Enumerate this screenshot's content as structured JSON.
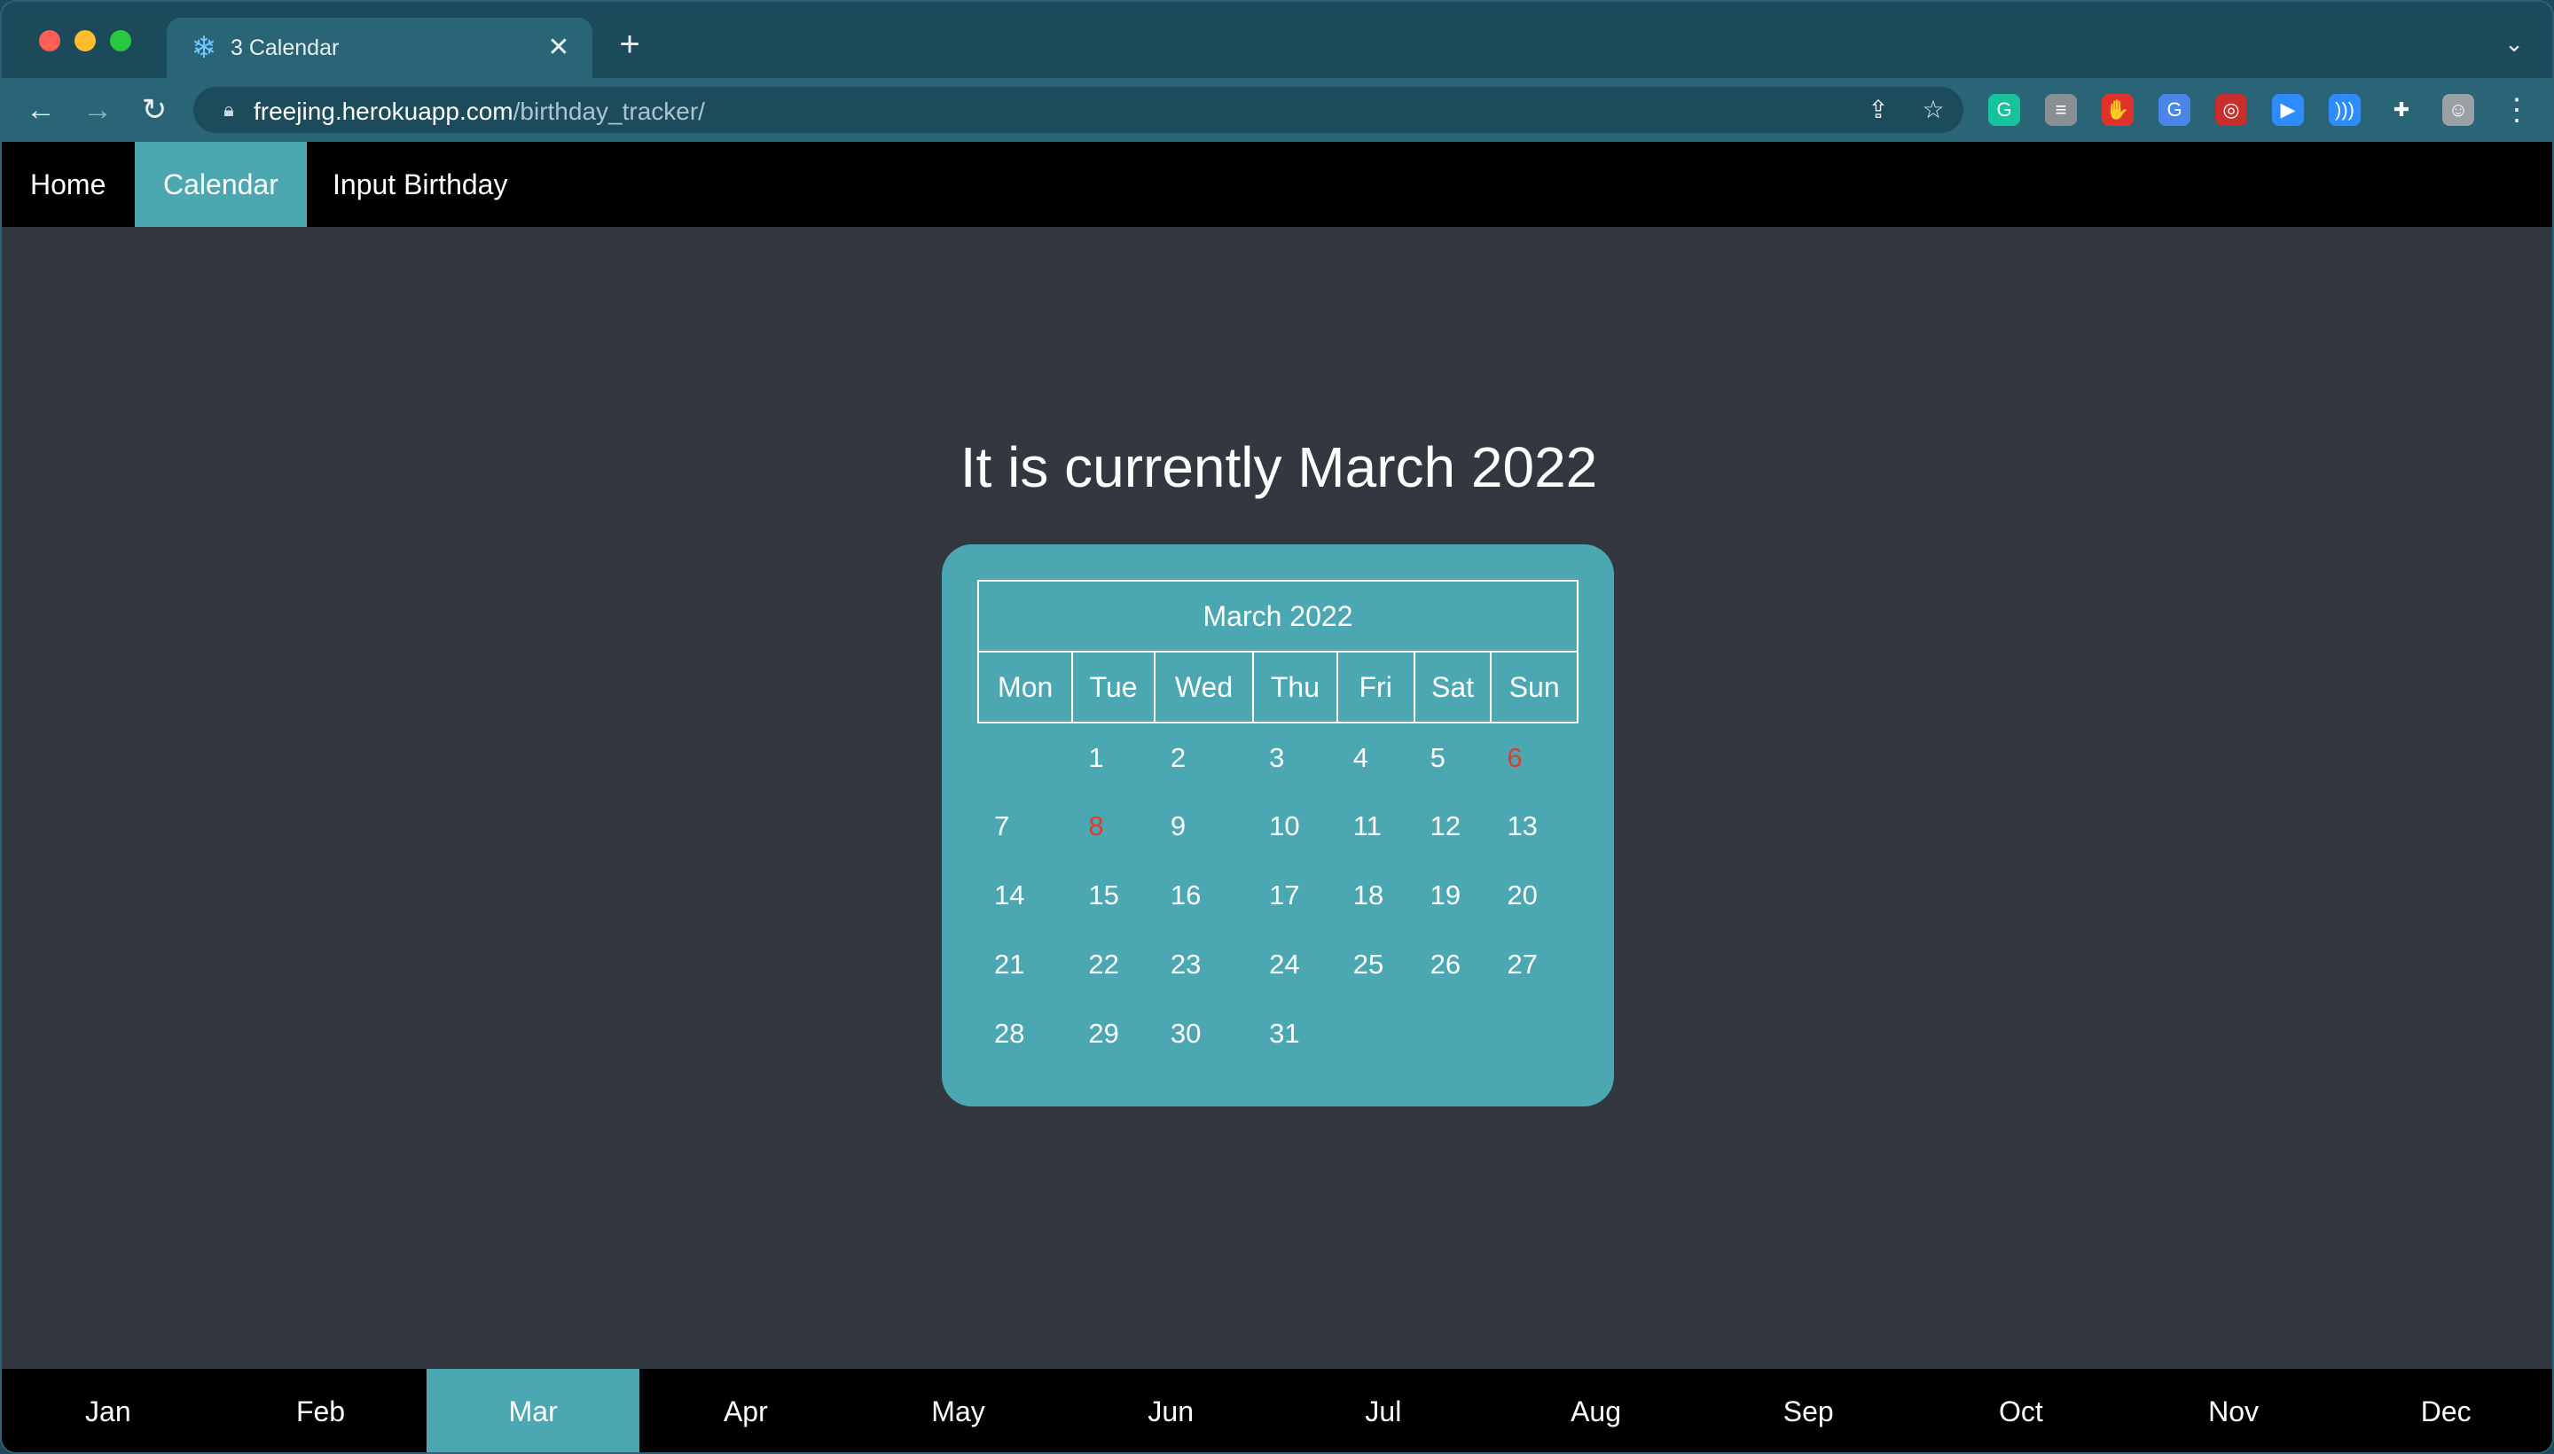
{
  "browser": {
    "tab_title": "3 Calendar",
    "tab_favicon": "snowflake-icon",
    "url_host": "freejing.herokuapp.com",
    "url_path": "/birthday_tracker/",
    "extensions": [
      {
        "name": "grammarly-icon",
        "glyph": "G",
        "color": "#15c39a"
      },
      {
        "name": "chat-extension-icon",
        "glyph": "≡",
        "color": "#8a8f96"
      },
      {
        "name": "stop-hand-icon",
        "glyph": "✋",
        "color": "#e0322b"
      },
      {
        "name": "translate-icon",
        "glyph": "G",
        "color": "#4a86e8"
      },
      {
        "name": "glasses-extension-icon",
        "glyph": "◎",
        "color": "#c9302c"
      },
      {
        "name": "zoom-icon",
        "glyph": "▶",
        "color": "#2d8cff"
      },
      {
        "name": "audio-waves-icon",
        "glyph": ")))",
        "color": "#2d8cff"
      },
      {
        "name": "puzzle-icon",
        "glyph": "✚",
        "color": "#2a6477"
      },
      {
        "name": "profile-avatar-icon",
        "glyph": "☺",
        "color": "#9aa0a6"
      }
    ]
  },
  "nav": {
    "items": [
      {
        "label": "Home",
        "active": false
      },
      {
        "label": "Calendar",
        "active": true
      },
      {
        "label": "Input Birthday",
        "active": false
      }
    ]
  },
  "main": {
    "heading": "It is currently March 2022"
  },
  "calendar": {
    "title": "March 2022",
    "weekdays": [
      "Mon",
      "Tue",
      "Wed",
      "Thu",
      "Fri",
      "Sat",
      "Sun"
    ],
    "weeks": [
      [
        "",
        "1",
        "2",
        "3",
        "4",
        "5",
        "6"
      ],
      [
        "7",
        "8",
        "9",
        "10",
        "11",
        "12",
        "13"
      ],
      [
        "14",
        "15",
        "16",
        "17",
        "18",
        "19",
        "20"
      ],
      [
        "21",
        "22",
        "23",
        "24",
        "25",
        "26",
        "27"
      ],
      [
        "28",
        "29",
        "30",
        "31",
        "",
        "",
        ""
      ]
    ],
    "highlighted_days": [
      "6",
      "8"
    ],
    "highlight_color": "#e23b2e"
  },
  "months": {
    "items": [
      "Jan",
      "Feb",
      "Mar",
      "Apr",
      "May",
      "Jun",
      "Jul",
      "Aug",
      "Sep",
      "Oct",
      "Nov",
      "Dec"
    ],
    "active": "Mar"
  },
  "colors": {
    "accent": "#4ba8b3",
    "background": "#333840",
    "navbar": "#000000"
  }
}
